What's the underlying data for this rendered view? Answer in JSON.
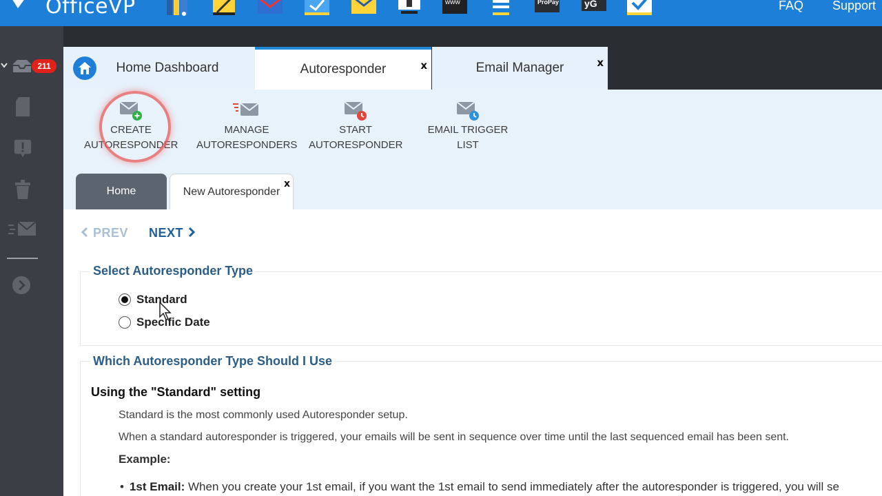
{
  "topbar": {
    "brand": "OfficeVP",
    "faq": "FAQ",
    "support": "Support",
    "app_icons": [
      "books-icon",
      "notepad-icon",
      "email-icon",
      "calendar-check-icon",
      "envelope-icon",
      "presentation-icon",
      "www-icon",
      "list-icon",
      "propay-icon",
      "social-icon",
      "checklist-icon"
    ],
    "propay_label": "ProPay",
    "www_label": "www",
    "social_label": "yG"
  },
  "sidebar": {
    "inbox_count": "211"
  },
  "app_tabs": [
    {
      "label": "Home Dashboard",
      "close": ""
    },
    {
      "label": "Autoresponder",
      "close": "x"
    },
    {
      "label": "Email Manager",
      "close": "x"
    }
  ],
  "toolbar": {
    "create": {
      "line1": "CREATE",
      "line2": "AUTORESPONDER"
    },
    "manage": {
      "line1": "MANAGE",
      "line2": "AUTORESPONDERS"
    },
    "start": {
      "line1": "START",
      "line2": "AUTORESPONDER"
    },
    "trigger": {
      "line1": "EMAIL TRIGGER",
      "line2": "LIST"
    }
  },
  "subtabs": {
    "home": "Home",
    "new": "New Autoresponder",
    "close": "x"
  },
  "nav": {
    "prev": "PREV",
    "next": "NEXT"
  },
  "type_select": {
    "legend": "Select Autoresponder Type",
    "options": [
      {
        "label": "Standard",
        "checked": true
      },
      {
        "label": "Specific Date",
        "checked": false
      }
    ]
  },
  "help": {
    "legend": "Which Autoresponder Type Should I Use",
    "section_title": "Using the \"Standard\" setting",
    "para1": "Standard is the most commonly used Autoresponder setup.",
    "para2": "When a standard autoresponder is triggered, your emails will be sent in sequence over time until the last sequenced email has been sent.",
    "example": "Example:",
    "bullet_label": "1st Email:",
    "bullet_text": " When you create your 1st email, if you want the 1st email to send immediately after the autoresponder is triggered, you will se"
  },
  "colors": {
    "topbar": "#1e7fd8",
    "sidebar": "#3b3f45",
    "accent": "#1f8ad8",
    "badge": "#e0221b",
    "legend": "#2b5d86"
  }
}
